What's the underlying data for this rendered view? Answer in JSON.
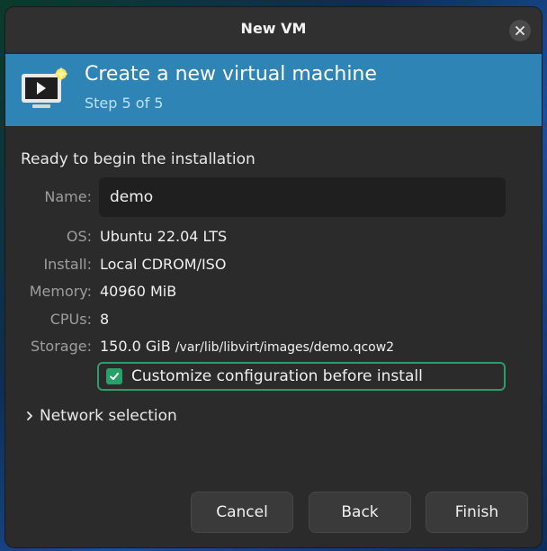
{
  "window": {
    "title": "New VM",
    "close_icon": "close-icon"
  },
  "banner": {
    "heading": "Create a new virtual machine",
    "step": "Step 5 of 5",
    "icon": "vm-monitor-icon"
  },
  "summary": {
    "ready_text": "Ready to begin the installation",
    "name": {
      "label": "Name:",
      "value": "demo"
    },
    "os": {
      "label": "OS:",
      "value": "Ubuntu 22.04 LTS"
    },
    "install": {
      "label": "Install:",
      "value": "Local CDROM/ISO"
    },
    "memory": {
      "label": "Memory:",
      "value": "40960 MiB"
    },
    "cpus": {
      "label": "CPUs:",
      "value": "8"
    },
    "storage": {
      "label": "Storage:",
      "size": "150.0 GiB",
      "path": "/var/lib/libvirt/images/demo.qcow2"
    }
  },
  "customize": {
    "label": "Customize configuration before install",
    "checked": true
  },
  "network": {
    "label": "Network selection",
    "expanded": false
  },
  "buttons": {
    "cancel": "Cancel",
    "back": "Back",
    "finish": "Finish"
  },
  "colors": {
    "banner": "#2f84b6",
    "accent_green": "#26a269",
    "dialog_bg": "#2b2b2b"
  }
}
